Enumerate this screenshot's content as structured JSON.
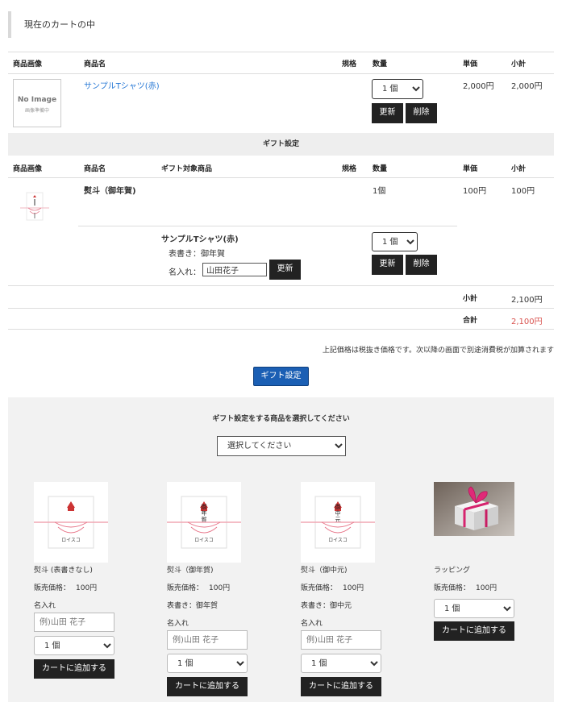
{
  "cart": {
    "title": "現在のカートの中",
    "headers": {
      "image": "商品画像",
      "name": "商品名",
      "spec": "規格",
      "qty": "数量",
      "unit_price": "単価",
      "subtotal": "小計"
    },
    "item": {
      "noimage_line1": "No Image",
      "noimage_line2": "画像準備中",
      "name": "サンプルTシャツ(赤)",
      "qty": "1 個",
      "unit_price": "2,000円",
      "subtotal": "2,000円",
      "update_label": "更新",
      "delete_label": "削除"
    }
  },
  "gift_settings": {
    "band_title": "ギフト設定",
    "headers": {
      "image": "商品画像",
      "name": "商品名",
      "target": "ギフト対象商品",
      "spec": "規格",
      "qty": "数量",
      "unit_price": "単価",
      "subtotal": "小計"
    },
    "noshi": {
      "name": "熨斗（御年賀)",
      "qty": "1個",
      "unit_price": "100円",
      "subtotal": "100円"
    },
    "target": {
      "product": "サンプルTシャツ(赤)",
      "omotegaki": "表書き：御年賀",
      "naire_label": "名入れ：",
      "naire_value": "山田花子",
      "update_label": "更新",
      "qty": "1 個",
      "update2_label": "更新",
      "delete_label": "削除"
    }
  },
  "totals": {
    "subtotal_label": "小計",
    "subtotal_value": "2,100円",
    "total_label": "合計",
    "total_value": "2,100円",
    "tax_note": "上記価格は税抜き価格です。次以降の画面で別途消費税が加算されます"
  },
  "gift_button": "ギフト設定",
  "gift_panel": {
    "title": "ギフト設定をする商品を選択してください",
    "select_placeholder": "選択してください",
    "products": [
      {
        "name": "熨斗 (表書きなし)",
        "price_label": "販売価格：",
        "price": "100円",
        "naire_label": "名入れ",
        "input_placeholder": "例)山田 花子",
        "qty": "1 個",
        "add_label": "カートに追加する"
      },
      {
        "name": "熨斗（御年賀)",
        "price_label": "販売価格：",
        "price": "100円",
        "omotegaki": "表書き：御年賀",
        "naire_label": "名入れ",
        "input_placeholder": "例)山田 花子",
        "qty": "1 個",
        "add_label": "カートに追加する"
      },
      {
        "name": "熨斗（御中元)",
        "price_label": "販売価格：",
        "price": "100円",
        "omotegaki": "表書き：御中元",
        "naire_label": "名入れ",
        "input_placeholder": "例)山田 花子",
        "qty": "1 個",
        "add_label": "カートに追加する"
      },
      {
        "name": "ラッピング",
        "price_label": "販売価格：",
        "price": "100円",
        "qty": "1 個",
        "add_label": "カートに追加する"
      }
    ]
  },
  "colors": {
    "accent_red": "#d9534f",
    "link_blue": "#2a7ad6",
    "button_blue": "#1b5fb4",
    "button_dark": "#222222"
  }
}
